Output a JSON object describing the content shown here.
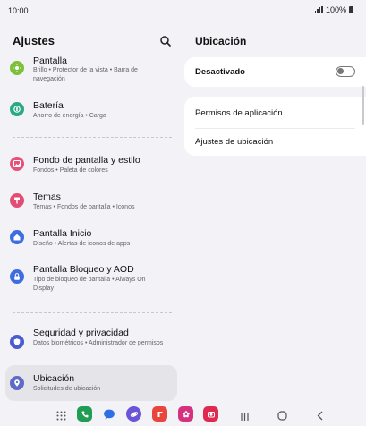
{
  "status": {
    "time": "10:00",
    "battery": "100%"
  },
  "left_panel": {
    "title": "Ajustes",
    "items": [
      {
        "title": "Pantalla",
        "subtitle": "Brillo • Protector de la vista • Barra de navegación",
        "icon": "sun-icon",
        "color": "#7cc13a"
      },
      {
        "title": "Batería",
        "subtitle": "Ahorro de energía • Carga",
        "icon": "battery-icon",
        "color": "#2aa985"
      },
      {
        "title": "Fondo de pantalla y estilo",
        "subtitle": "Fondos • Paleta de colores",
        "icon": "wallpaper-icon",
        "color": "#e6517a"
      },
      {
        "title": "Temas",
        "subtitle": "Temas • Fondos de pantalla • Iconos",
        "icon": "brush-icon",
        "color": "#e34c73"
      },
      {
        "title": "Pantalla Inicio",
        "subtitle": "Diseño • Alertas de iconos de apps",
        "icon": "home-icon",
        "color": "#3f6de0"
      },
      {
        "title": "Pantalla Bloqueo y AOD",
        "subtitle": "Tipo de bloqueo de pantalla • Always On Display",
        "icon": "lock-icon",
        "color": "#3f6de0"
      },
      {
        "title": "Seguridad y privacidad",
        "subtitle": "Datos biométricos • Administrador de permisos",
        "icon": "shield-icon",
        "color": "#4b5bd0"
      },
      {
        "title": "Ubicación",
        "subtitle": "Solicitudes de ubicación",
        "icon": "location-pin-icon",
        "color": "#5c6bc8"
      }
    ]
  },
  "right_panel": {
    "title": "Ubicación",
    "toggle_label": "Desactivado",
    "toggle_on": false,
    "options": [
      "Permisos de aplicación",
      "Ajustes de ubicación"
    ]
  },
  "navbar": {
    "apps": [
      {
        "icon": "phone-app-icon",
        "color": "#1f9d55"
      },
      {
        "icon": "messages-app-icon",
        "color": "#2f6fe4"
      },
      {
        "icon": "internet-app-icon",
        "color": "#6a54d8"
      },
      {
        "icon": "gallery-app-icon",
        "color": "#e8453c"
      },
      {
        "icon": "blossom-app-icon",
        "color": "#d6317f"
      },
      {
        "icon": "camera-app-icon",
        "color": "#e0294f"
      }
    ]
  }
}
